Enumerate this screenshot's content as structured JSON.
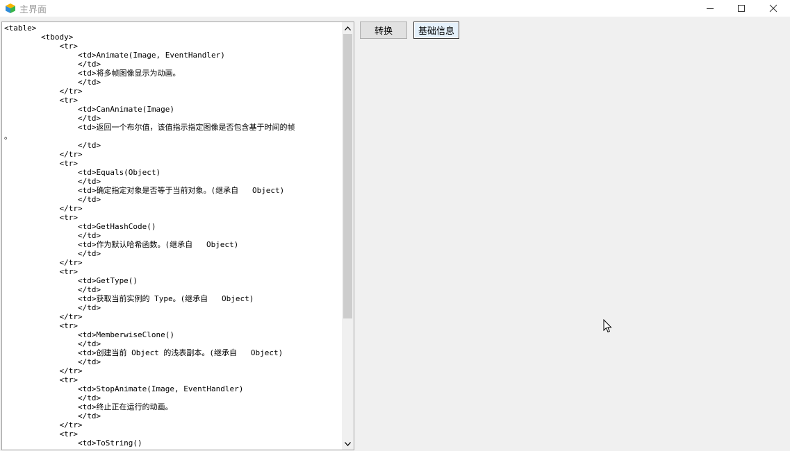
{
  "window": {
    "title": "主界面",
    "controls": [
      "minimize-icon",
      "maximize-icon",
      "close-icon"
    ]
  },
  "editor": {
    "lines": [
      "<table>",
      "        <tbody>",
      "            <tr>",
      "                <td>Animate(Image, EventHandler)",
      "                </td>",
      "                <td>将多帧图像显示为动画。",
      "                </td>",
      "            </tr>",
      "            <tr>",
      "                <td>CanAnimate(Image)",
      "                </td>",
      "                <td>返回一个布尔值，该值指示指定图像是否包含基于时间的帧",
      "。",
      "                </td>",
      "            </tr>",
      "            <tr>",
      "                <td>Equals(Object)",
      "                </td>",
      "                <td>确定指定对象是否等于当前对象。(继承自   Object)",
      "                </td>",
      "            </tr>",
      "            <tr>",
      "                <td>GetHashCode()",
      "                </td>",
      "                <td>作为默认哈希函数。(继承自   Object)",
      "                </td>",
      "            </tr>",
      "            <tr>",
      "                <td>GetType()",
      "                </td>",
      "                <td>获取当前实例的 Type。(继承自   Object)",
      "                </td>",
      "            </tr>",
      "            <tr>",
      "                <td>MemberwiseClone()",
      "                </td>",
      "                <td>创建当前 Object 的浅表副本。(继承自   Object)",
      "                </td>",
      "            </tr>",
      "            <tr>",
      "                <td>StopAnimate(Image, EventHandler)",
      "                </td>",
      "                <td>终止正在运行的动画。",
      "                </td>",
      "            </tr>",
      "            <tr>",
      "                <td>ToString()"
    ]
  },
  "toolbar": {
    "convert_label": "转换",
    "info_label": "基础信息"
  }
}
